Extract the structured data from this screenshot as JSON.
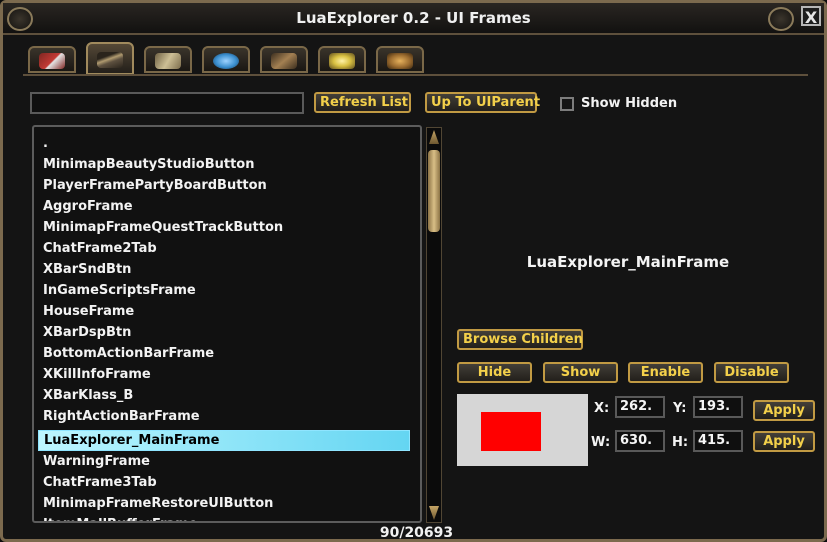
{
  "window": {
    "title": "LuaExplorer 0.2 - UI Frames",
    "close_label": "X"
  },
  "tabs": [
    {
      "icon": "red-tools-icon",
      "color": "#c23a34"
    },
    {
      "icon": "sword-icon",
      "color": "#8a7a5b",
      "active": true
    },
    {
      "icon": "book-icon",
      "color": "#cdbf95"
    },
    {
      "icon": "blue-orb-icon",
      "color": "#3b8fcf"
    },
    {
      "icon": "bird-icon",
      "color": "#a38052"
    },
    {
      "icon": "potion-icon",
      "color": "#d9c142"
    },
    {
      "icon": "helmet-icon",
      "color": "#9a6a2e"
    }
  ],
  "toolbar": {
    "search_value": "",
    "refresh_label": "Refresh List",
    "up_label": "Up To UIParent",
    "show_hidden_label": "Show Hidden"
  },
  "list": {
    "items": [
      ".",
      "MinimapBeautyStudioButton",
      "PlayerFramePartyBoardButton",
      "AggroFrame",
      "MinimapFrameQuestTrackButton",
      "ChatFrame2Tab",
      "XBarSndBtn",
      "InGameScriptsFrame",
      "HouseFrame",
      "XBarDspBtn",
      "BottomActionBarFrame",
      "XKillInfoFrame",
      "XBarKlass_B",
      "RightActionBarFrame",
      "LuaExplorer_MainFrame",
      "WarningFrame",
      "ChatFrame3Tab",
      "MinimapFrameRestoreUIButton",
      "ItemMallBufferFrame"
    ],
    "selected_index": 14,
    "count": "90/20693"
  },
  "details": {
    "frame_name": "LuaExplorer_MainFrame",
    "browse_label": "Browse Children",
    "hide_label": "Hide",
    "show_label": "Show",
    "enable_label": "Enable",
    "disable_label": "Disable",
    "x_label": "X:",
    "y_label": "Y:",
    "w_label": "W:",
    "h_label": "H:",
    "x_value": "262.",
    "y_value": "193.",
    "w_value": "630.",
    "h_value": "415.",
    "apply_label": "Apply",
    "preview_bg": "#d6d6d6",
    "preview_color": "#ff0000"
  }
}
